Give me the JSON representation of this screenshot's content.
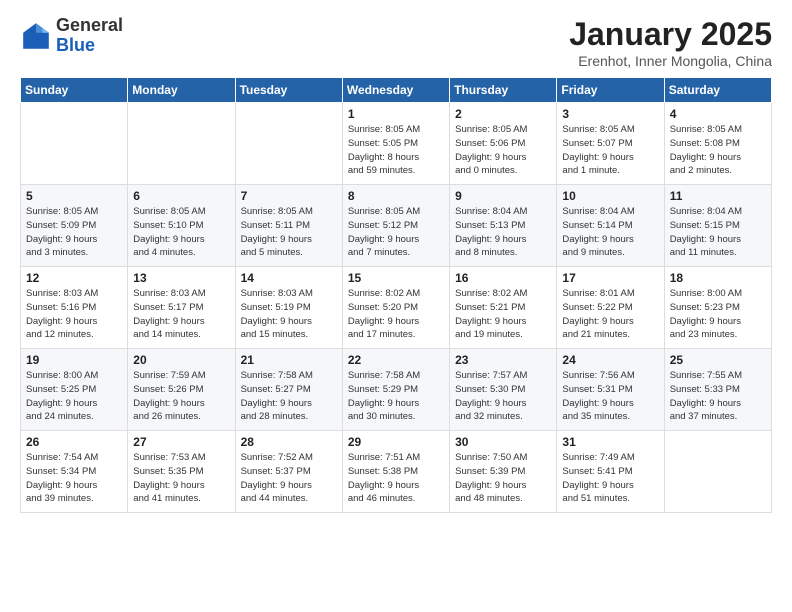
{
  "header": {
    "logo_general": "General",
    "logo_blue": "Blue",
    "month_title": "January 2025",
    "subtitle": "Erenhot, Inner Mongolia, China"
  },
  "days_of_week": [
    "Sunday",
    "Monday",
    "Tuesday",
    "Wednesday",
    "Thursday",
    "Friday",
    "Saturday"
  ],
  "weeks": [
    [
      {
        "day": "",
        "info": ""
      },
      {
        "day": "",
        "info": ""
      },
      {
        "day": "",
        "info": ""
      },
      {
        "day": "1",
        "info": "Sunrise: 8:05 AM\nSunset: 5:05 PM\nDaylight: 8 hours\nand 59 minutes."
      },
      {
        "day": "2",
        "info": "Sunrise: 8:05 AM\nSunset: 5:06 PM\nDaylight: 9 hours\nand 0 minutes."
      },
      {
        "day": "3",
        "info": "Sunrise: 8:05 AM\nSunset: 5:07 PM\nDaylight: 9 hours\nand 1 minute."
      },
      {
        "day": "4",
        "info": "Sunrise: 8:05 AM\nSunset: 5:08 PM\nDaylight: 9 hours\nand 2 minutes."
      }
    ],
    [
      {
        "day": "5",
        "info": "Sunrise: 8:05 AM\nSunset: 5:09 PM\nDaylight: 9 hours\nand 3 minutes."
      },
      {
        "day": "6",
        "info": "Sunrise: 8:05 AM\nSunset: 5:10 PM\nDaylight: 9 hours\nand 4 minutes."
      },
      {
        "day": "7",
        "info": "Sunrise: 8:05 AM\nSunset: 5:11 PM\nDaylight: 9 hours\nand 5 minutes."
      },
      {
        "day": "8",
        "info": "Sunrise: 8:05 AM\nSunset: 5:12 PM\nDaylight: 9 hours\nand 7 minutes."
      },
      {
        "day": "9",
        "info": "Sunrise: 8:04 AM\nSunset: 5:13 PM\nDaylight: 9 hours\nand 8 minutes."
      },
      {
        "day": "10",
        "info": "Sunrise: 8:04 AM\nSunset: 5:14 PM\nDaylight: 9 hours\nand 9 minutes."
      },
      {
        "day": "11",
        "info": "Sunrise: 8:04 AM\nSunset: 5:15 PM\nDaylight: 9 hours\nand 11 minutes."
      }
    ],
    [
      {
        "day": "12",
        "info": "Sunrise: 8:03 AM\nSunset: 5:16 PM\nDaylight: 9 hours\nand 12 minutes."
      },
      {
        "day": "13",
        "info": "Sunrise: 8:03 AM\nSunset: 5:17 PM\nDaylight: 9 hours\nand 14 minutes."
      },
      {
        "day": "14",
        "info": "Sunrise: 8:03 AM\nSunset: 5:19 PM\nDaylight: 9 hours\nand 15 minutes."
      },
      {
        "day": "15",
        "info": "Sunrise: 8:02 AM\nSunset: 5:20 PM\nDaylight: 9 hours\nand 17 minutes."
      },
      {
        "day": "16",
        "info": "Sunrise: 8:02 AM\nSunset: 5:21 PM\nDaylight: 9 hours\nand 19 minutes."
      },
      {
        "day": "17",
        "info": "Sunrise: 8:01 AM\nSunset: 5:22 PM\nDaylight: 9 hours\nand 21 minutes."
      },
      {
        "day": "18",
        "info": "Sunrise: 8:00 AM\nSunset: 5:23 PM\nDaylight: 9 hours\nand 23 minutes."
      }
    ],
    [
      {
        "day": "19",
        "info": "Sunrise: 8:00 AM\nSunset: 5:25 PM\nDaylight: 9 hours\nand 24 minutes."
      },
      {
        "day": "20",
        "info": "Sunrise: 7:59 AM\nSunset: 5:26 PM\nDaylight: 9 hours\nand 26 minutes."
      },
      {
        "day": "21",
        "info": "Sunrise: 7:58 AM\nSunset: 5:27 PM\nDaylight: 9 hours\nand 28 minutes."
      },
      {
        "day": "22",
        "info": "Sunrise: 7:58 AM\nSunset: 5:29 PM\nDaylight: 9 hours\nand 30 minutes."
      },
      {
        "day": "23",
        "info": "Sunrise: 7:57 AM\nSunset: 5:30 PM\nDaylight: 9 hours\nand 32 minutes."
      },
      {
        "day": "24",
        "info": "Sunrise: 7:56 AM\nSunset: 5:31 PM\nDaylight: 9 hours\nand 35 minutes."
      },
      {
        "day": "25",
        "info": "Sunrise: 7:55 AM\nSunset: 5:33 PM\nDaylight: 9 hours\nand 37 minutes."
      }
    ],
    [
      {
        "day": "26",
        "info": "Sunrise: 7:54 AM\nSunset: 5:34 PM\nDaylight: 9 hours\nand 39 minutes."
      },
      {
        "day": "27",
        "info": "Sunrise: 7:53 AM\nSunset: 5:35 PM\nDaylight: 9 hours\nand 41 minutes."
      },
      {
        "day": "28",
        "info": "Sunrise: 7:52 AM\nSunset: 5:37 PM\nDaylight: 9 hours\nand 44 minutes."
      },
      {
        "day": "29",
        "info": "Sunrise: 7:51 AM\nSunset: 5:38 PM\nDaylight: 9 hours\nand 46 minutes."
      },
      {
        "day": "30",
        "info": "Sunrise: 7:50 AM\nSunset: 5:39 PM\nDaylight: 9 hours\nand 48 minutes."
      },
      {
        "day": "31",
        "info": "Sunrise: 7:49 AM\nSunset: 5:41 PM\nDaylight: 9 hours\nand 51 minutes."
      },
      {
        "day": "",
        "info": ""
      }
    ]
  ]
}
